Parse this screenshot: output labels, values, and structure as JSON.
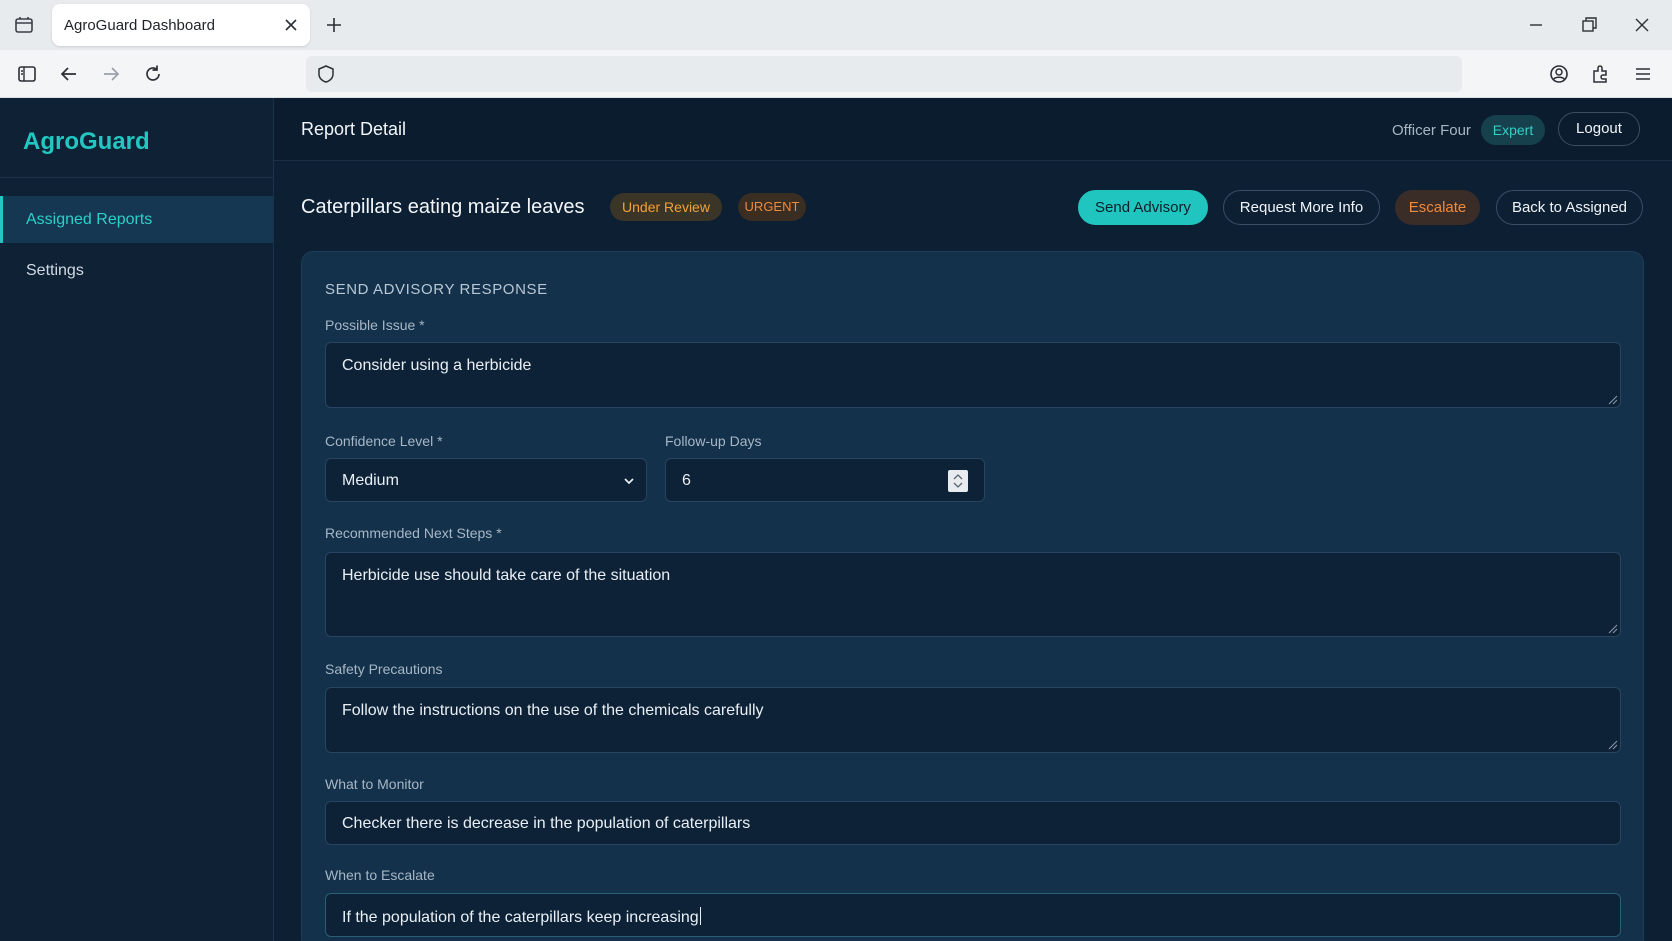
{
  "browser": {
    "tab_title": "AgroGuard Dashboard"
  },
  "app": {
    "brand": "AgroGuard",
    "accent_color": "#22c7c2"
  },
  "sidebar": {
    "items": [
      {
        "label": "Assigned Reports",
        "active": true
      },
      {
        "label": "Settings",
        "active": false
      }
    ]
  },
  "topbar": {
    "page_title": "Report Detail",
    "user_name": "Officer Four",
    "role": "Expert",
    "logout_label": "Logout"
  },
  "report": {
    "title": "Caterpillars eating maize leaves",
    "status": "Under Review",
    "priority": "URGENT",
    "actions": {
      "send_advisory": "Send Advisory",
      "request_info": "Request More Info",
      "escalate": "Escalate",
      "back": "Back to Assigned"
    }
  },
  "form": {
    "section_title": "SEND ADVISORY RESPONSE",
    "possible_issue": {
      "label": "Possible Issue *",
      "value": "Consider using a herbicide"
    },
    "confidence": {
      "label": "Confidence Level *",
      "value": "Medium"
    },
    "followup": {
      "label": "Follow-up Days",
      "value": "6"
    },
    "next_steps": {
      "label": "Recommended Next Steps *",
      "value": "Herbicide use should take care of the situation"
    },
    "safety": {
      "label": "Safety Precautions",
      "value": "Follow the instructions on the use of the chemicals carefully"
    },
    "monitor": {
      "label": "What to Monitor",
      "value": "Checker there is decrease in the population of caterpillars"
    },
    "escalate_when": {
      "label": "When to Escalate",
      "value": "If the population of the caterpillars keep increasing"
    }
  }
}
